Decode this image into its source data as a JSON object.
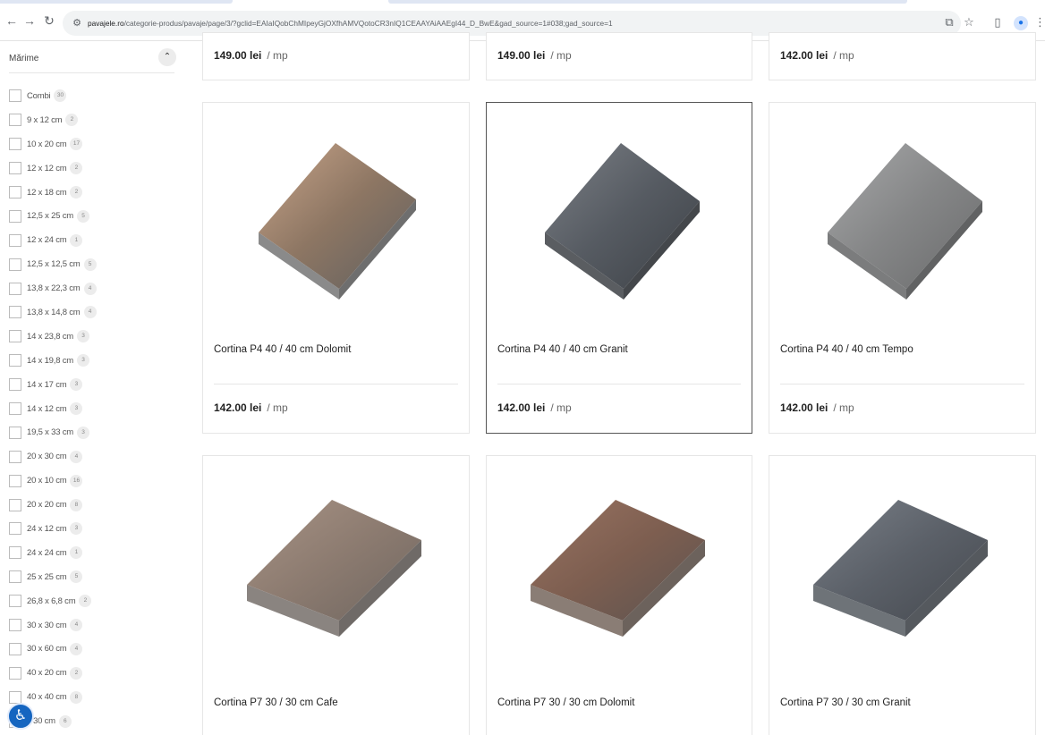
{
  "browser": {
    "url_host": "pavajele.ro",
    "url_path": "/categorie-produs/pavaje/page/3/?gclid=EAIaIQobChMIpeyGjOXfhAMVQotoCR3nIQ1CEAAYAiAAEgI44_D_BwE&gad_source=1#038;gad_source=1"
  },
  "sidebar": {
    "title": "Mărime",
    "filters": [
      {
        "label": "Combi",
        "count": "30"
      },
      {
        "label": "9 x 12 cm",
        "count": "2"
      },
      {
        "label": "10 x 20 cm",
        "count": "17"
      },
      {
        "label": "12 x 12 cm",
        "count": "2"
      },
      {
        "label": "12 x 18 cm",
        "count": "2"
      },
      {
        "label": "12,5 x 25 cm",
        "count": "5"
      },
      {
        "label": "12 x 24 cm",
        "count": "1"
      },
      {
        "label": "12,5 x 12,5 cm",
        "count": "5"
      },
      {
        "label": "13,8 x 22,3 cm",
        "count": "4"
      },
      {
        "label": "13,8 x 14,8 cm",
        "count": "4"
      },
      {
        "label": "14 x 23,8 cm",
        "count": "3"
      },
      {
        "label": "14 x 19,8 cm",
        "count": "3"
      },
      {
        "label": "14 x 17 cm",
        "count": "3"
      },
      {
        "label": "14 x 12 cm",
        "count": "3"
      },
      {
        "label": "19,5 x 33 cm",
        "count": "3"
      },
      {
        "label": "20 x 30 cm",
        "count": "4"
      },
      {
        "label": "20 x 10 cm",
        "count": "16"
      },
      {
        "label": "20 x 20 cm",
        "count": "8"
      },
      {
        "label": "24 x 12 cm",
        "count": "3"
      },
      {
        "label": "24 x 24 cm",
        "count": "1"
      },
      {
        "label": "25 x 25 cm",
        "count": "5"
      },
      {
        "label": "26,8 x 6,8 cm",
        "count": "2"
      },
      {
        "label": "30 x 30 cm",
        "count": "4"
      },
      {
        "label": "30 x 60 cm",
        "count": "4"
      },
      {
        "label": "40 x 20 cm",
        "count": "2"
      },
      {
        "label": "40 x 40 cm",
        "count": "8"
      },
      {
        "label": "x 30 cm",
        "count": "6"
      }
    ]
  },
  "products": {
    "top_row": [
      {
        "price": "149.00 lei",
        "unit": "/ mp"
      },
      {
        "price": "149.00 lei",
        "unit": "/ mp"
      },
      {
        "price": "142.00 lei",
        "unit": "/ mp"
      }
    ],
    "middle_row": [
      {
        "name": "Cortina P4 40 / 40 cm Dolomit",
        "price": "142.00 lei",
        "unit": "/ mp",
        "colors": [
          "#c9a58a",
          "#8d7663",
          "#5f5f5f"
        ]
      },
      {
        "name": "Cortina P4 40 / 40 cm Granit",
        "price": "142.00 lei",
        "unit": "/ mp",
        "colors": [
          "#7c8086",
          "#565b62",
          "#3d4146"
        ]
      },
      {
        "name": "Cortina P4 40 / 40 cm Tempo",
        "price": "142.00 lei",
        "unit": "/ mp",
        "colors": [
          "#a8a9aa",
          "#858687",
          "#6a6b6c"
        ]
      }
    ],
    "bottom_row": [
      {
        "name": "Cortina P7 30 / 30 cm Cafe",
        "colors": [
          "#a89385",
          "#8c7b70",
          "#6f6660"
        ]
      },
      {
        "name": "Cortina P7 30 / 30 cm Dolomit",
        "colors": [
          "#9a7462",
          "#7d5e50",
          "#5b5350"
        ]
      },
      {
        "name": "Cortina P7 30 / 30 cm Granit",
        "colors": [
          "#7a8088",
          "#5b6068",
          "#45494f"
        ]
      }
    ]
  }
}
